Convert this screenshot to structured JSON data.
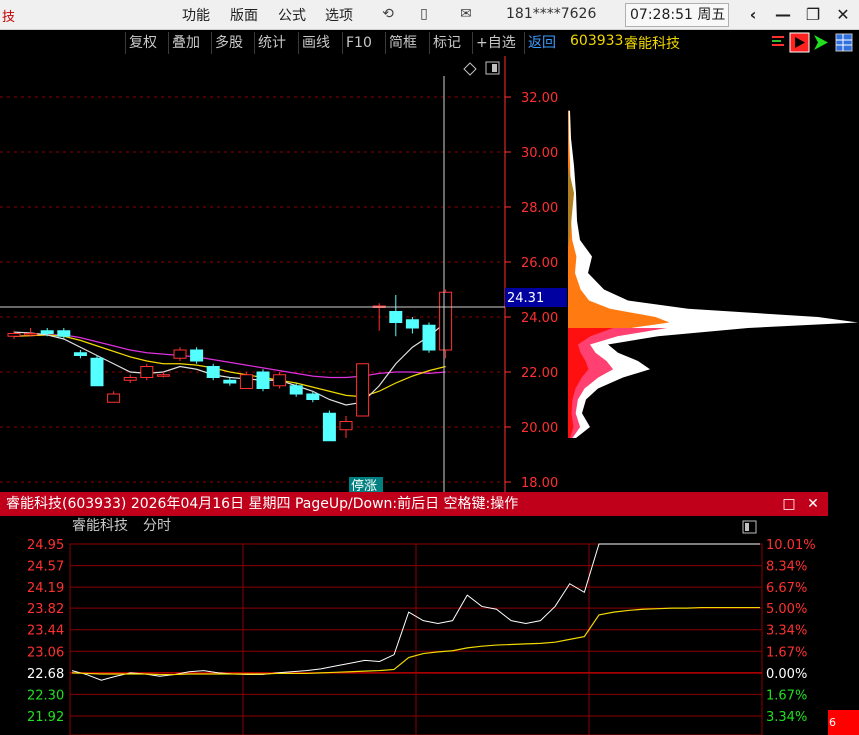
{
  "topbar": {
    "app_title_fragment": "技",
    "menus": [
      "功能",
      "版面",
      "公式",
      "选项"
    ],
    "account": "181****7626",
    "clock": "07:28:51 周五",
    "win_buttons": [
      "‹",
      "—",
      "❐",
      "✕"
    ]
  },
  "toolbar": {
    "buttons": [
      "复权",
      "叠加",
      "多股",
      "统计",
      "画线",
      "F10",
      "简框",
      "标记",
      "+自选",
      "返回"
    ]
  },
  "stock": {
    "code": "603933",
    "name": "睿能科技"
  },
  "kchart": {
    "price_axis": [
      "32.00",
      "30.00",
      "28.00",
      "26.00",
      "24.00",
      "22.00",
      "20.00",
      "18.00"
    ],
    "cursor_price": "24.31",
    "tag_text": "停涨"
  },
  "subwin": {
    "title": "睿能科技(603933) 2026年04月16日 星期四 PageUp/Down:前后日 空格键:操作",
    "chart_label_name": "睿能科技",
    "chart_label_type": "分时",
    "left_axis": [
      "24.95",
      "24.57",
      "24.19",
      "23.82",
      "23.44",
      "23.06",
      "22.68",
      "22.30",
      "21.92"
    ],
    "right_axis": [
      "10.01%",
      "8.34%",
      "6.67%",
      "5.00%",
      "3.34%",
      "1.67%",
      "0.00%",
      "1.67%",
      "3.34%"
    ],
    "close_btn": "✕",
    "max_btn": "□"
  },
  "corner_badge": "6",
  "colors": {
    "up": "#ff3030",
    "down": "#54ffff",
    "price_line": "#ffffff",
    "avg_line": "#f0d800",
    "grid": "#8b0000",
    "accent": "#c0001a"
  },
  "chart_data": {
    "type": "candlestick",
    "candles": [
      {
        "o": 23.3,
        "h": 23.5,
        "l": 23.2,
        "c": 23.4
      },
      {
        "o": 23.4,
        "h": 23.6,
        "l": 23.3,
        "c": 23.4
      },
      {
        "o": 23.5,
        "h": 23.6,
        "l": 23.3,
        "c": 23.4
      },
      {
        "o": 23.5,
        "h": 23.6,
        "l": 23.2,
        "c": 23.3
      },
      {
        "o": 22.7,
        "h": 22.8,
        "l": 22.5,
        "c": 22.6
      },
      {
        "o": 22.5,
        "h": 22.6,
        "l": 21.5,
        "c": 21.5
      },
      {
        "o": 20.9,
        "h": 21.3,
        "l": 20.9,
        "c": 21.2
      },
      {
        "o": 21.7,
        "h": 21.9,
        "l": 21.6,
        "c": 21.8
      },
      {
        "o": 21.8,
        "h": 22.3,
        "l": 21.7,
        "c": 22.2
      },
      {
        "o": 21.9,
        "h": 22.0,
        "l": 21.8,
        "c": 21.9
      },
      {
        "o": 22.5,
        "h": 22.9,
        "l": 22.4,
        "c": 22.8
      },
      {
        "o": 22.8,
        "h": 22.9,
        "l": 22.3,
        "c": 22.4
      },
      {
        "o": 22.2,
        "h": 22.3,
        "l": 21.7,
        "c": 21.8
      },
      {
        "o": 21.7,
        "h": 21.8,
        "l": 21.5,
        "c": 21.6
      },
      {
        "o": 21.4,
        "h": 22.0,
        "l": 21.4,
        "c": 21.9
      },
      {
        "o": 22.0,
        "h": 22.1,
        "l": 21.3,
        "c": 21.4
      },
      {
        "o": 21.5,
        "h": 22.0,
        "l": 21.4,
        "c": 21.9
      },
      {
        "o": 21.5,
        "h": 21.6,
        "l": 21.1,
        "c": 21.2
      },
      {
        "o": 21.2,
        "h": 21.3,
        "l": 20.9,
        "c": 21.0
      },
      {
        "o": 20.5,
        "h": 20.6,
        "l": 19.5,
        "c": 19.5
      },
      {
        "o": 19.9,
        "h": 20.4,
        "l": 19.6,
        "c": 20.2
      },
      {
        "o": 20.4,
        "h": 22.3,
        "l": 20.4,
        "c": 22.3
      },
      {
        "o": 24.4,
        "h": 24.5,
        "l": 23.5,
        "c": 24.4
      },
      {
        "o": 24.2,
        "h": 24.8,
        "l": 23.3,
        "c": 23.8
      },
      {
        "o": 23.9,
        "h": 24.0,
        "l": 23.4,
        "c": 23.6
      },
      {
        "o": 23.7,
        "h": 23.8,
        "l": 22.7,
        "c": 22.8
      },
      {
        "o": 22.8,
        "h": 25.0,
        "l": 22.5,
        "c": 24.9
      }
    ],
    "ma_white": [
      23.45,
      23.42,
      23.35,
      23.2,
      22.9,
      22.6,
      22.3,
      22.0,
      21.95,
      22.0,
      22.2,
      22.1,
      21.9,
      21.8,
      21.75,
      21.7,
      21.7,
      21.5,
      21.3,
      21.0,
      20.8,
      20.9,
      21.5,
      22.3,
      22.9,
      23.3,
      23.8
    ],
    "ma_yellow": [
      23.3,
      23.32,
      23.35,
      23.3,
      23.15,
      22.95,
      22.75,
      22.55,
      22.4,
      22.3,
      22.3,
      22.25,
      22.15,
      22.0,
      21.9,
      21.8,
      21.7,
      21.6,
      21.45,
      21.3,
      21.15,
      21.1,
      21.3,
      21.6,
      21.85,
      22.05,
      22.2
    ],
    "ma_magenta": [
      23.3,
      23.32,
      23.35,
      23.35,
      23.25,
      23.1,
      22.95,
      22.8,
      22.7,
      22.65,
      22.6,
      22.55,
      22.45,
      22.35,
      22.25,
      22.15,
      22.05,
      21.95,
      21.85,
      21.8,
      21.8,
      21.85,
      21.95,
      22.0,
      22.0,
      21.95,
      22.0
    ],
    "minute_price": [
      22.72,
      22.65,
      22.55,
      22.62,
      22.68,
      22.66,
      22.62,
      22.65,
      22.7,
      22.72,
      22.68,
      22.66,
      22.65,
      22.65,
      22.68,
      22.7,
      22.72,
      22.75,
      22.8,
      22.85,
      22.9,
      22.88,
      23.0,
      23.75,
      23.6,
      23.55,
      23.6,
      24.05,
      23.85,
      23.8,
      23.6,
      23.55,
      23.6,
      23.85,
      24.25,
      24.1,
      24.95,
      24.95,
      24.95,
      24.95,
      24.95,
      24.95,
      24.95,
      24.95,
      24.95,
      24.95,
      24.95,
      24.95
    ],
    "minute_avg": [
      22.68,
      22.67,
      22.66,
      22.66,
      22.66,
      22.66,
      22.65,
      22.65,
      22.66,
      22.66,
      22.66,
      22.66,
      22.66,
      22.66,
      22.67,
      22.67,
      22.67,
      22.68,
      22.69,
      22.7,
      22.71,
      22.72,
      22.74,
      22.95,
      23.02,
      23.05,
      23.07,
      23.12,
      23.15,
      23.17,
      23.18,
      23.19,
      23.2,
      23.22,
      23.27,
      23.32,
      23.7,
      23.75,
      23.78,
      23.8,
      23.81,
      23.82,
      23.82,
      23.83,
      23.83,
      23.83,
      23.83,
      23.83
    ],
    "price_profile": [
      {
        "price": 31.5,
        "w": 2
      },
      {
        "price": 30.5,
        "w": 3
      },
      {
        "price": 29.5,
        "w": 6
      },
      {
        "price": 28.5,
        "w": 8
      },
      {
        "price": 27.5,
        "w": 9
      },
      {
        "price": 26.8,
        "w": 12
      },
      {
        "price": 26.2,
        "w": 24
      },
      {
        "price": 25.6,
        "w": 20
      },
      {
        "price": 25.0,
        "w": 36
      },
      {
        "price": 24.6,
        "w": 60
      },
      {
        "price": 24.3,
        "w": 120
      },
      {
        "price": 24.0,
        "w": 250
      },
      {
        "price": 23.8,
        "w": 290
      },
      {
        "price": 23.6,
        "w": 180
      },
      {
        "price": 23.3,
        "w": 90
      },
      {
        "price": 23.0,
        "w": 40
      },
      {
        "price": 22.7,
        "w": 50
      },
      {
        "price": 22.4,
        "w": 70
      },
      {
        "price": 22.1,
        "w": 82
      },
      {
        "price": 21.8,
        "w": 55
      },
      {
        "price": 21.4,
        "w": 30
      },
      {
        "price": 21.0,
        "w": 18
      },
      {
        "price": 20.5,
        "w": 14
      },
      {
        "price": 20.0,
        "w": 22
      },
      {
        "price": 19.6,
        "w": 8
      }
    ]
  }
}
